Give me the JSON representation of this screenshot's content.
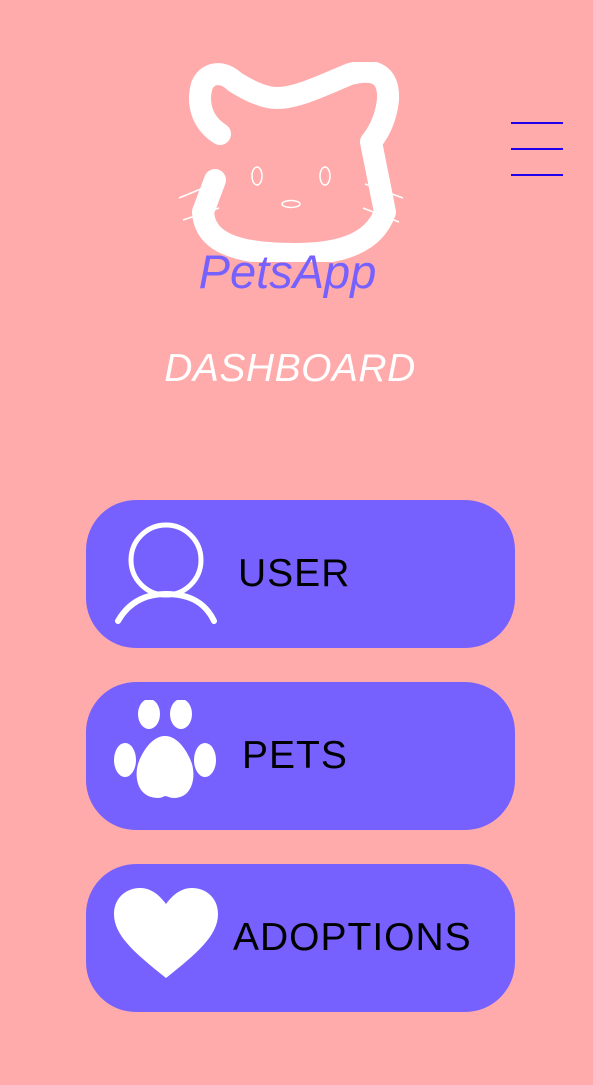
{
  "header": {
    "logo_icon": "cat-face-icon",
    "app_name": "PetsApp",
    "page_title": "DASHBOARD",
    "menu_icon": "hamburger-menu-icon"
  },
  "nav": {
    "items": [
      {
        "label": "USER",
        "icon": "user-icon"
      },
      {
        "label": "PETS",
        "icon": "paw-icon"
      },
      {
        "label": "ADOPTIONS",
        "icon": "heart-icon"
      }
    ]
  },
  "colors": {
    "background": "#FFABAB",
    "accent": "#7661FF",
    "menu": "#2200EE",
    "icon": "#FFFFFF"
  }
}
